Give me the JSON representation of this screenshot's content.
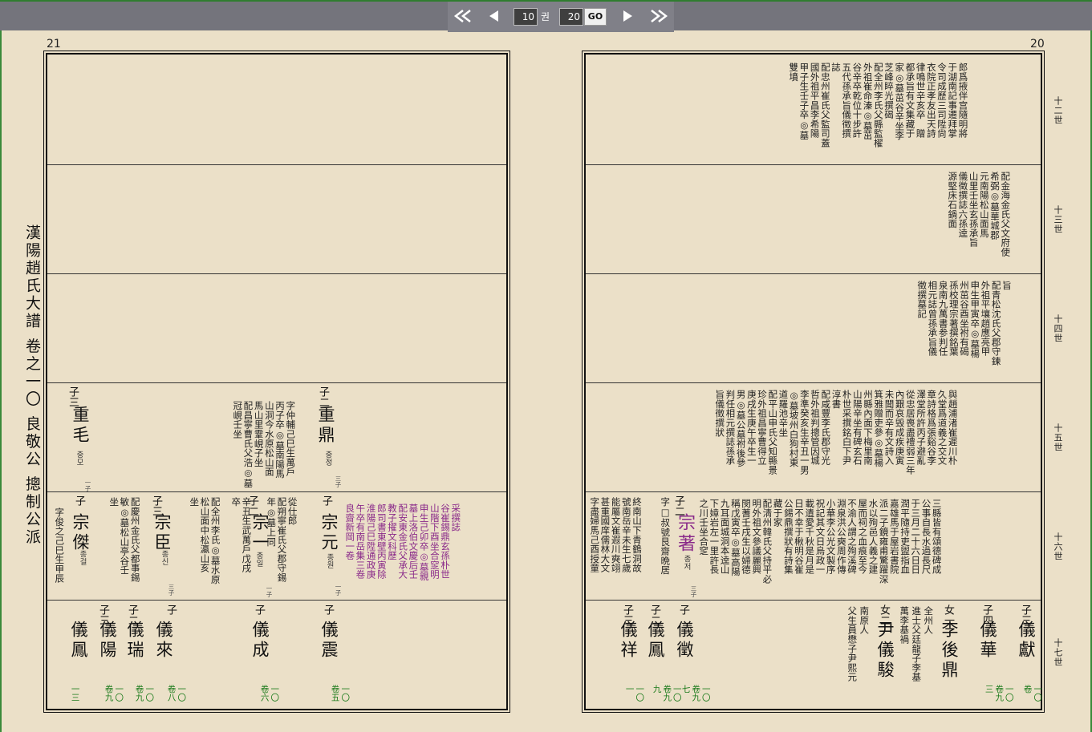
{
  "toolbar": {
    "first_icon": "double-left-icon",
    "prev_icon": "left-arrow-icon",
    "current_volume": "10",
    "unit": "권",
    "goto_value": "20",
    "go_label": "GO",
    "next_icon": "right-arrow-icon",
    "last_icon": "double-right-icon"
  },
  "pages": {
    "left_number": "21",
    "right_number": "20"
  },
  "spine_title": "漢陽趙氏大譜 卷之一〇 良敬公 摠制公派",
  "generations": [
    "十二世",
    "十三世",
    "十四世",
    "十五世",
    "十六世",
    "十七世"
  ],
  "right_page": {
    "band1": [
      "郎爲掖伴宫隨明將",
      "于湖南記事遷拜掌",
      "令司成歷三司陞尙",
      "衣院正孝友出天詩",
      "律鳴世辛亥卒　贈",
      "都承旨有文集藏于",
      "家◎墓茁谷辛坐李",
      "芝峰睟光撰碣",
      "配全州李氏父縣監櫂",
      "外祖崔命溱◎墓茁",
      "谷辛卒乾位十步許",
      "五代孫承旨儀徵撰",
      "誌",
      "配忠州崔氏父監司蓋",
      "國外祖平昌李希陽",
      "甲子生壬子卒◎墓",
      "雙墳"
    ],
    "band2": [
      "配金海金氏父文府使",
      "希弼◎墓華城郡",
      "元南陽松山面馬",
      "山里壬坐玄孫承旨",
      "儀徵撰誌六孫逵",
      "源堅床石鍋面"
    ],
    "band3": [
      "旨",
      "配青松沈氏父郡守鍊",
      "外祖平壤趙應亮甲",
      "申生甲寅卒◎墓楊",
      "州茁谷酉坐祔有碣",
      "孫校理宗著撰銘葉",
      "泉南九萬書参判任",
      "相元誌曾孫承旨儀",
      "徵撰墓記"
    ],
    "band4": [
      "與趙浦渚崔遲川朴",
      "久堂爲道義之交文",
      "章詩格爲張谿谷李",
      "澤堂所許丙子避亂",
      "從忠居喪盡禮弱三年",
      "內艱哀毁成疾庚寅",
      "未聞而辛有文詩入",
      "箕雅贈吏參◎墓楊",
      "州縣內面下梅里南",
      "山陽辛坐有碑玄石",
      "朴世采撰銘白下尹",
      "淳書",
      "配咸豐李氏郡守光",
      "哲外祖判摠管因城",
      "李準癸亥生辛丑一男",
      "◎墓坡州白狗村東",
      "道羅池辛坐",
      "配平山申氏父知縣景",
      "珍外祖昌寧曹得立",
      "庚戌生庚午卒生一",
      "男◎墓公墓祔後參",
      "判任相元撰誌孫承",
      "旨儀徵撰狀"
    ],
    "band5": [
      "三縣皆有頌德碑成",
      "公事自長水過長尺",
      "于三月二十六日日",
      "潤平隨持吏盥指血",
      "嘉雄馬于屋岩書院",
      "派二子鏡雍甫驚躍深",
      "水以殉邑人義之建",
      "屋而祠之血痕至今",
      "不渝人謂之殉溪碑",
      "淵泉洪公奭周作傳",
      "小華李公光文製序",
      "祝記其文日烏政一",
      "載遺愛千秋是月是",
      "日不幸于楸明谷崔",
      "公錫鼎撰狀有詩集",
      "藏于家",
      "配淸州韓氏父持平必",
      "明外祖文參議麗興",
      "閔蓍壬戌生以婦德",
      "稱戊寅卒◎墓高陽",
      "九耳面城洞本逵山",
      "下嫜岩左一里許長",
      "之川壬坐合窆"
    ],
    "band5_person": {
      "rel": "子二",
      "name": "宗著",
      "kor": "종저",
      "tiny": "三子",
      "sub": "字□叔號艮齋晩居",
      "notes": [
        "終南山下青鶴洞故",
        "號南岳辛未生七歲",
        "能屬文崔遐川奭翊",
        "甚重國庠儒林大文",
        "字盡婦馬己酉授童"
      ]
    },
    "band6": [
      {
        "rel": "子三",
        "name": "儀獻",
        "volume": "一〇卷"
      },
      {
        "rel": "子四",
        "name": "儀華",
        "volume": "一〇卷九三"
      },
      {
        "rel": "女一",
        "name": "李後鼎",
        "volume": "",
        "notes": [
          "全州人",
          "進士父廷龍子李基",
          "萬李基禍"
        ]
      },
      {
        "rel": "女二",
        "name": "尹儀駿",
        "volume": "",
        "notes": [
          "南原人",
          "父生員懋子尹熙元"
        ]
      },
      {
        "rel": "子",
        "name": "儀徵",
        "volume": "一〇卷九七"
      },
      {
        "rel": "子二",
        "name": "儀鳳",
        "volume": "一〇卷九九"
      },
      {
        "rel": "子三",
        "name": "儀祥",
        "volume": "一〇一"
      }
    ]
  },
  "left_page": {
    "band4": [
      {
        "rel": "子三",
        "name": "重毛",
        "kor": "중모",
        "tiny": "一子"
      },
      {
        "rel": "子二",
        "name": "重鼎",
        "kor": "중정",
        "tiny": "三子",
        "notes": [
          "字仲輔己巳生萬戶",
          "丙子卒◎墓南陽馬",
          "山洞今水原松山面",
          "馬山里䨣峴子坐"
        ],
        "spouse": [
          "配昌寧曹氏父浩◎墓",
          "冠峴壬坐"
        ]
      }
    ],
    "band5": [
      {
        "rel": "子",
        "name": "宗元",
        "kor": "종원",
        "tiny": "一子",
        "notes": [
          "教子擢文科歷",
          "郎司書東壁丙寅除",
          "淮陽己巳陞通政庚",
          "午卒有南岳集三卷",
          "良齋新岡一卷"
        ],
        "purple": [
          "配安東金氏父承大",
          "墓上洛伯文慶后壬",
          "申生己卯卒◎墓親",
          "山階下酉坐合窆明",
          "谷崔錫鼎玄孫朴世",
          "采撰誌"
        ]
      },
      {
        "rel": "子二",
        "name": "宗一",
        "kor": "종일",
        "tiny": "一子",
        "notes": [
          "從仕郎",
          "配朔寧崔氏父郡守錫",
          "年◎墓上同"
        ],
        "extra": [
          "辛丑生武萬戶戊戌",
          "卒"
        ]
      },
      {
        "rel": "子三",
        "name": "宗臣",
        "kor": "종신",
        "tiny": "三子",
        "notes": [
          "配全州李氏◎墓水原",
          "松山面中松瀛山亥",
          "坐"
        ],
        "spouse": [
          "配慶州金氏父都事錫",
          "敏◎墓松山亭谷壬",
          "坐"
        ]
      },
      {
        "rel": "子",
        "name": "宗傑",
        "kor": "종걸",
        "tiny": "",
        "notes": [
          "字俊之己巳生甲辰"
        ]
      }
    ],
    "band6": [
      {
        "rel": "子",
        "name": "儀震",
        "volume": "一〇卷五"
      },
      {
        "rel": "子",
        "name": "儀成",
        "volume": "一〇卷六"
      },
      {
        "rel": "子",
        "name": "儀來",
        "volume": "一〇卷八"
      },
      {
        "rel": "子二",
        "name": "儀瑞",
        "volume": "一〇卷九"
      },
      {
        "rel": "子三",
        "name": "儀陽",
        "volume": "一〇卷九"
      },
      {
        "rel": "",
        "name": "儀鳳",
        "volume": "一三"
      }
    ]
  }
}
